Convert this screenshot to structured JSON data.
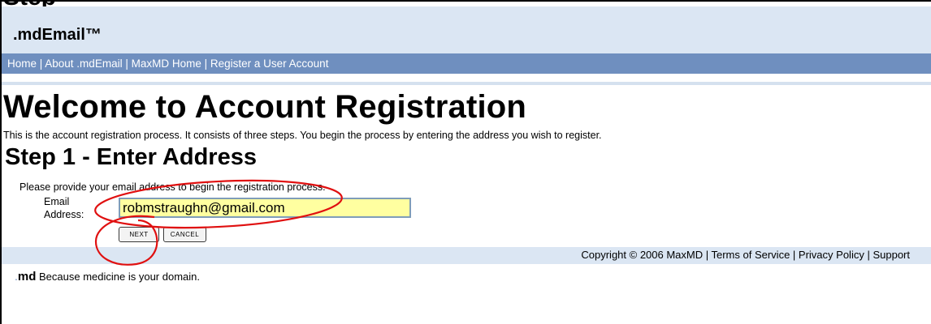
{
  "top_cut_text": "Step",
  "header": {
    "brand": ".mdEmail™"
  },
  "nav": {
    "items": [
      "Home",
      "About .mdEmail",
      "MaxMD Home",
      "Register a User Account"
    ],
    "separator": " | "
  },
  "main": {
    "title": "Welcome to Account Registration",
    "intro": "This is the account registration process. It consists of three steps. You begin the process by entering the address you wish to register.",
    "step_title": "Step 1 - Enter Address",
    "instruction": "Please provide your email address to begin the registration process.",
    "email_label_line1": "Email",
    "email_label_line2": "Address:",
    "email_value": "robmstraughn@gmail.com",
    "next_label": "NEXT",
    "cancel_label": "CANCEL"
  },
  "footer": {
    "copyright": "Copyright © 2006 MaxMD",
    "links": [
      "Terms of Service",
      "Privacy Policy",
      "Support"
    ],
    "separator": " | "
  },
  "tagline": {
    "logo": "md",
    "text": " Because medicine is your domain."
  },
  "colors": {
    "header_bg": "#dbe6f3",
    "nav_bg": "#6f8fbf",
    "input_bg": "#ffffa0",
    "annotation_red": "#e01010"
  }
}
